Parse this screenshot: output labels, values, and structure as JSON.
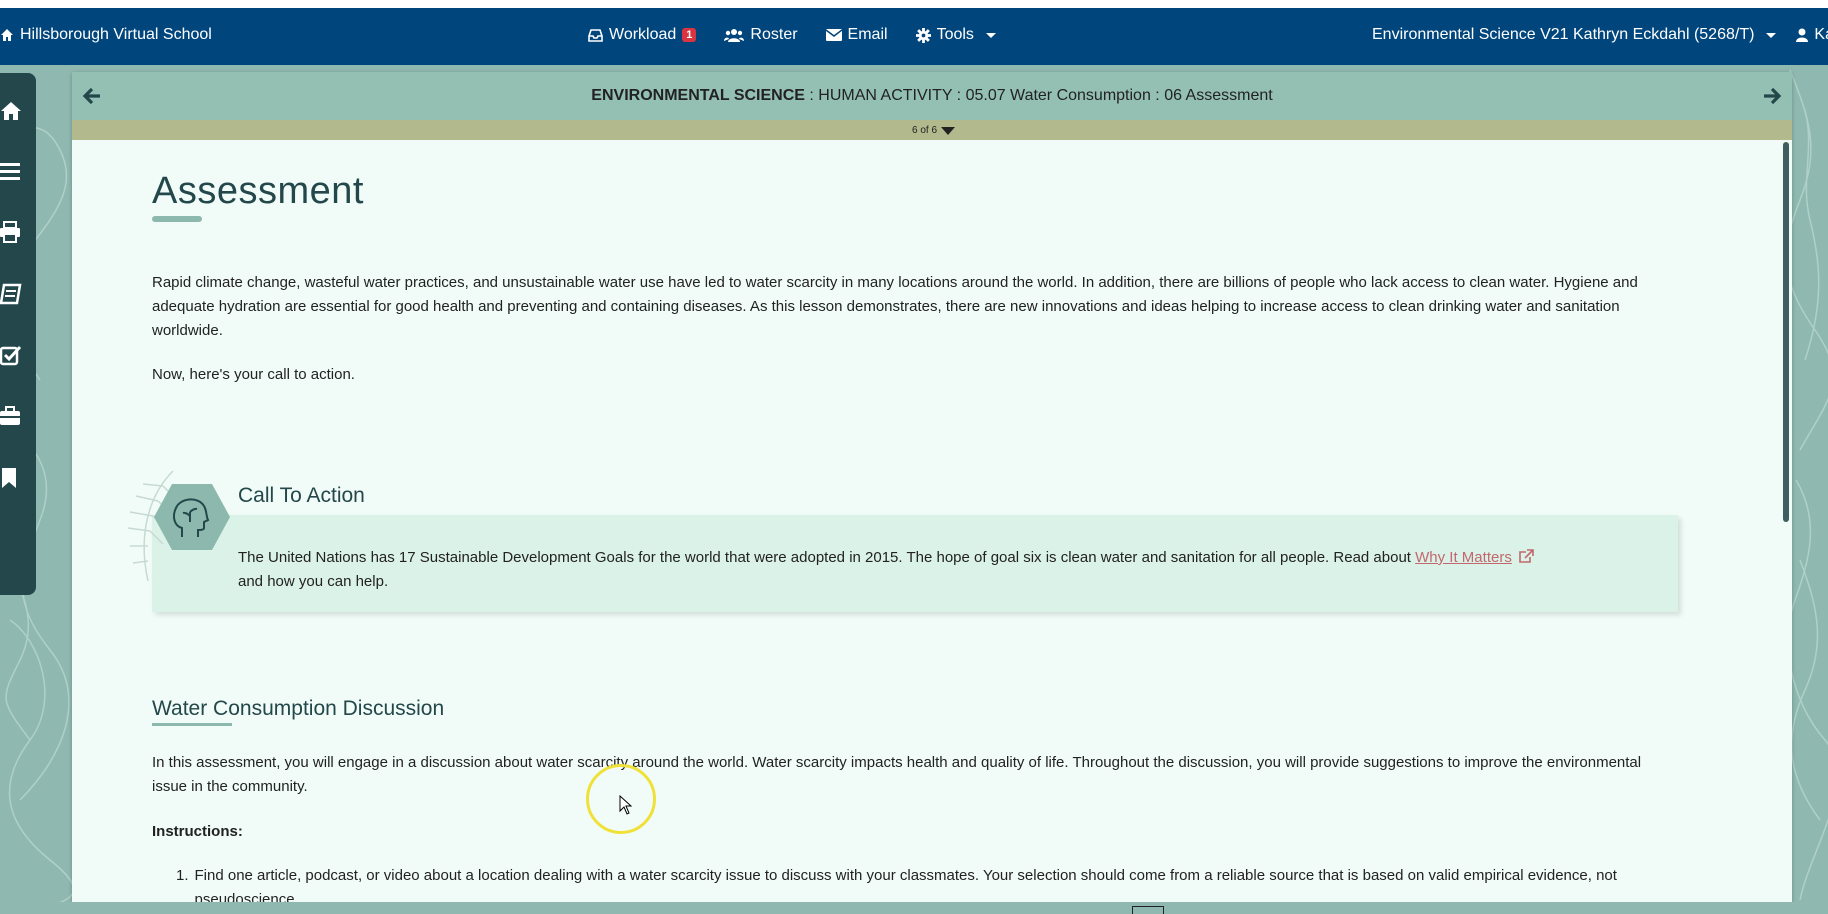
{
  "navbar": {
    "brand": "Hillsborough Virtual School",
    "workload_label": "Workload",
    "workload_count": "1",
    "roster_label": "Roster",
    "email_label": "Email",
    "tools_label": "Tools",
    "course_label": "Environmental Science V21 Kathryn Eckdahl (5268/T)",
    "user_label": "Kathr"
  },
  "breadcrumb": {
    "subject": "ENVIRONMENTAL SCIENCE",
    "path": " : HUMAN ACTIVITY : 05.07 Water Consumption : 06 Assessment"
  },
  "pager": {
    "label": "6 of 6"
  },
  "main": {
    "title": "Assessment",
    "intro": "Rapid climate change, wasteful water practices, and unsustainable water use have led to water scarcity in many locations around the world. In addition, there are billions of people who lack access to clean water. Hygiene and adequate hydration are essential for good health and preventing and containing diseases. As this lesson demonstrates, there are new innovations and ideas helping to increase access to clean drinking water and sanitation worldwide.",
    "call_line": "Now, here's your call to action.",
    "cta": {
      "title": "Call To Action",
      "text_before": "The United Nations has 17 Sustainable Development Goals for the world that were adopted in 2015. The hope of goal six is clean water and sanitation for all people. Read about ",
      "link": "Why It Matters",
      "text_after": " and how you can help."
    },
    "discussion": {
      "title": "Water Consumption Discussion",
      "text": "In this assessment, you will engage in a discussion about water scarcity around the world. Water scarcity impacts health and quality of life. Throughout the discussion, you will provide suggestions to improve the environmental issue in the community.",
      "instructions_label": "Instructions:",
      "item1": "Find one article, podcast, or video about a location dealing with a water scarcity issue to discuss with your classmates. Your selection should come from a reliable source that is based on valid empirical evidence, not pseudoscience."
    }
  },
  "icons": {
    "sidebar": [
      "home-icon",
      "list-icon",
      "print-icon",
      "notes-icon",
      "check-square-icon",
      "briefcase-icon",
      "bookmark-icon"
    ]
  },
  "colors": {
    "navbar": "#00457c",
    "sidebar": "#23474a",
    "crumb_bar": "#94c0b4",
    "pager_bar": "#b2b98c",
    "panel": "#f1fcf8",
    "cta_box": "#dbf2e8",
    "link": "#c2686c",
    "badge": "#d9343f"
  }
}
